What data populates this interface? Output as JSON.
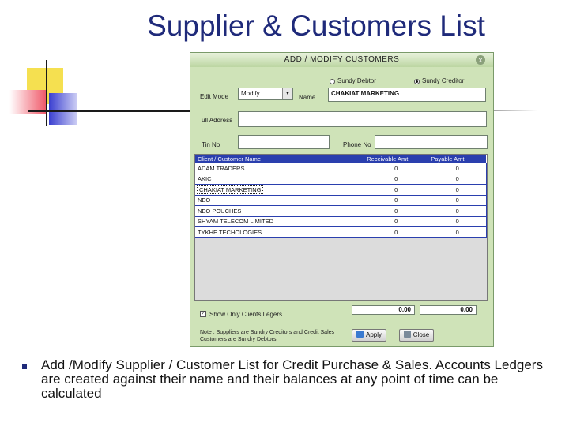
{
  "slide": {
    "title": "Supplier & Customers List",
    "bullet": "Add /Modify Supplier / Customer List for Credit Purchase & Sales. Accounts Ledgers are created against their name and their balances at any point of time can be calculated"
  },
  "dialog": {
    "title": "ADD / MODIFY CUSTOMERS",
    "close_glyph": "x",
    "radio_debtor": "Sundy Debtor",
    "radio_creditor": "Sundy Creditor",
    "selected_radio": "creditor",
    "edit_mode_label": "Edit Mode",
    "edit_mode_value": "Modify",
    "name_label": "Name",
    "name_value": "CHAKIAT MARKETING",
    "address_label": "ull Address",
    "address_value": "",
    "tin_label": "Tin No",
    "tin_value": "",
    "phone_label": "Phone No",
    "phone_value": "",
    "grid": {
      "headers": [
        "Client / Customer Name",
        "Receivable Amt",
        "Payable Amt"
      ],
      "rows": [
        {
          "name": "ADAM TRADERS",
          "receivable": "0",
          "payable": "0"
        },
        {
          "name": "AKIC",
          "receivable": "0",
          "payable": "0"
        },
        {
          "name": "CHAKIAT MARKETING",
          "receivable": "0",
          "payable": "0",
          "selected": true
        },
        {
          "name": "NEO",
          "receivable": "0",
          "payable": "0"
        },
        {
          "name": "NEO POUCHES",
          "receivable": "0",
          "payable": "0"
        },
        {
          "name": "SHYAM TELECOM LIMITED",
          "receivable": "0",
          "payable": "0"
        },
        {
          "name": "TYKHE TECHOLOGIES",
          "receivable": "0",
          "payable": "0"
        }
      ]
    },
    "show_only_clients_label": "Show Only Clients Legers",
    "show_only_clients_checked": true,
    "total_receivable": "0.00",
    "total_payable": "0.00",
    "note": "Note : Suppliers are Sundry Creditors and Credit Sales Customers are Sundry Debtors",
    "apply_label": "Apply",
    "close_label": "Close",
    "colors": {
      "grid_header": "#2a3fae",
      "dialog_bg": "#cfe3b8"
    }
  }
}
